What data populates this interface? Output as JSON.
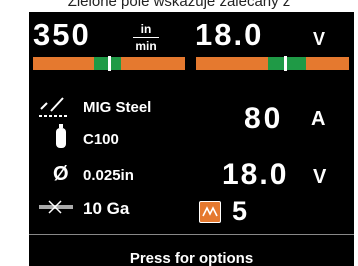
{
  "caption": "Zielone pole wskazuje zalecany z",
  "top": {
    "wfs_value": "350",
    "wfs_unit_num": "in",
    "wfs_unit_den": "min",
    "wfs_bar": {
      "zone_start": 0.4,
      "zone_end": 0.58,
      "marker": 0.5
    },
    "volt_value": "18.0",
    "volt_unit": "V",
    "volt_bar": {
      "zone_start": 0.47,
      "zone_end": 0.72,
      "marker": 0.58
    }
  },
  "rows": {
    "process_label": "MIG Steel",
    "gas_label": "C100",
    "wire_label": "0.025in",
    "diameter_glyph": "Ø",
    "thickness_label": "10 Ga"
  },
  "readouts": {
    "amps_value": "80",
    "amps_unit": "A",
    "volts_value": "18.0",
    "volts_unit": "V",
    "pinch_value": "5"
  },
  "footer": {
    "label": "Press for options"
  },
  "colors": {
    "bar": "#e5792f",
    "zone": "#1f9a46",
    "screen": "#000000"
  },
  "icons": [
    "weld-torch-icon",
    "gas-cylinder-icon",
    "diameter-icon",
    "material-thickness-icon",
    "pinch-icon"
  ]
}
